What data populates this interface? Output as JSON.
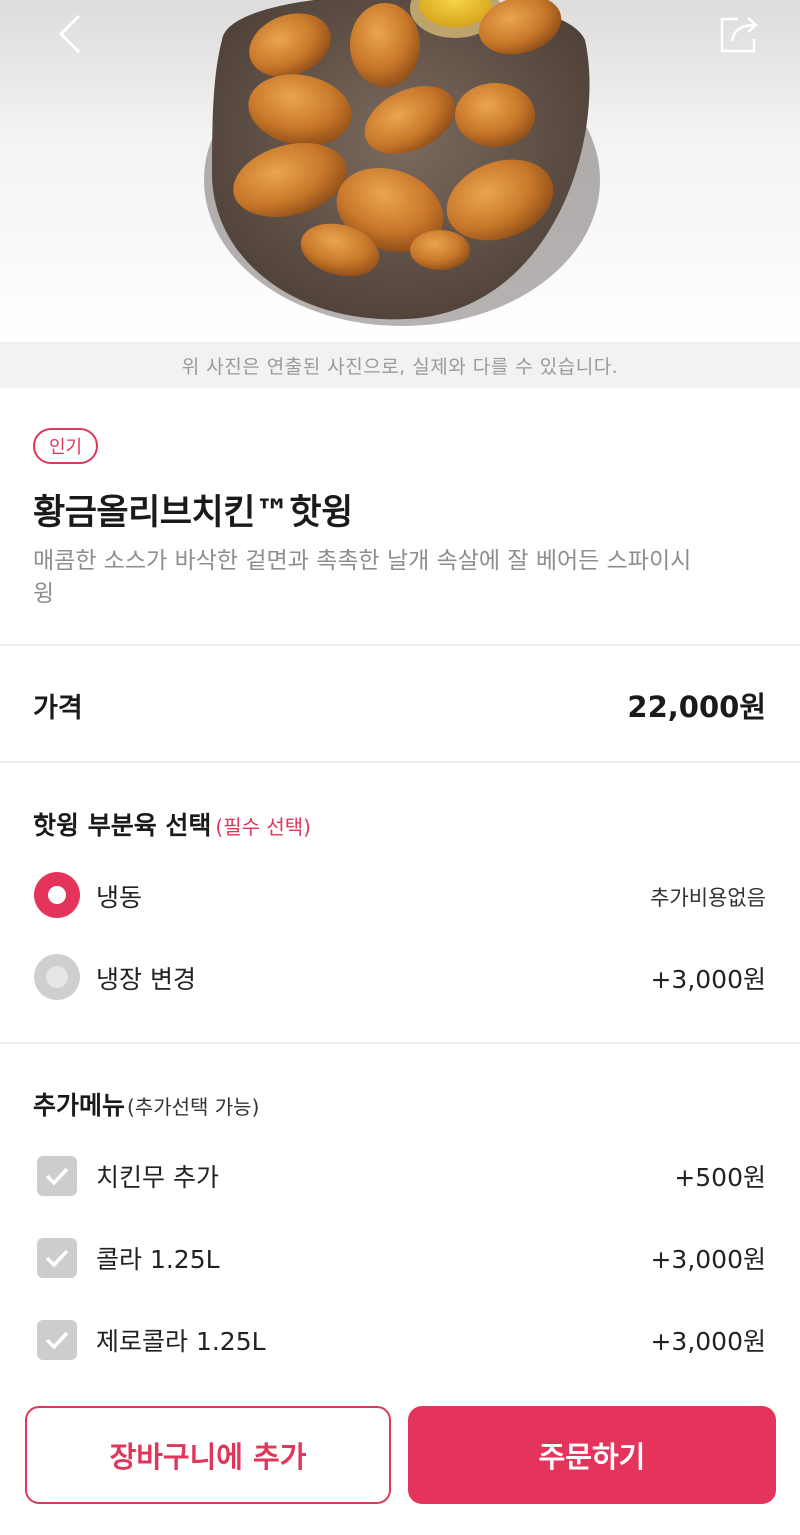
{
  "hero": {
    "image": "fried-chicken-plate-photo",
    "photo_note": "위 사진은 연출된 사진으로, 실제와 다를 수 있습니다."
  },
  "product": {
    "badge": "인기",
    "title": "황금올리브치킨™핫윙",
    "description": "매콤한 소스가 바삭한 겉면과 촉촉한 날개 속살에 잘 베어든 스파이시 윙"
  },
  "price": {
    "label": "가격",
    "value": "22,000원"
  },
  "part_select": {
    "title": "핫윙 부분육 선택",
    "required": "(필수 선택)",
    "options": [
      {
        "label": "냉동",
        "price": "추가비용없음",
        "selected": true
      },
      {
        "label": "냉장 변경",
        "price": "+3,000원",
        "selected": false
      }
    ]
  },
  "extra_menu": {
    "title": "추가메뉴",
    "note": "(추가선택 가능)",
    "items": [
      {
        "label": "치킨무 추가",
        "price": "+500원"
      },
      {
        "label": "콜라 1.25L",
        "price": "+3,000원"
      },
      {
        "label": "제로콜라 1.25L",
        "price": "+3,000원"
      }
    ]
  },
  "actions": {
    "add_to_cart": "장바구니에 추가",
    "order": "주문하기"
  },
  "colors": {
    "accent": "#e5345b",
    "muted_text": "#8e8e8e",
    "divider": "#ededed"
  }
}
